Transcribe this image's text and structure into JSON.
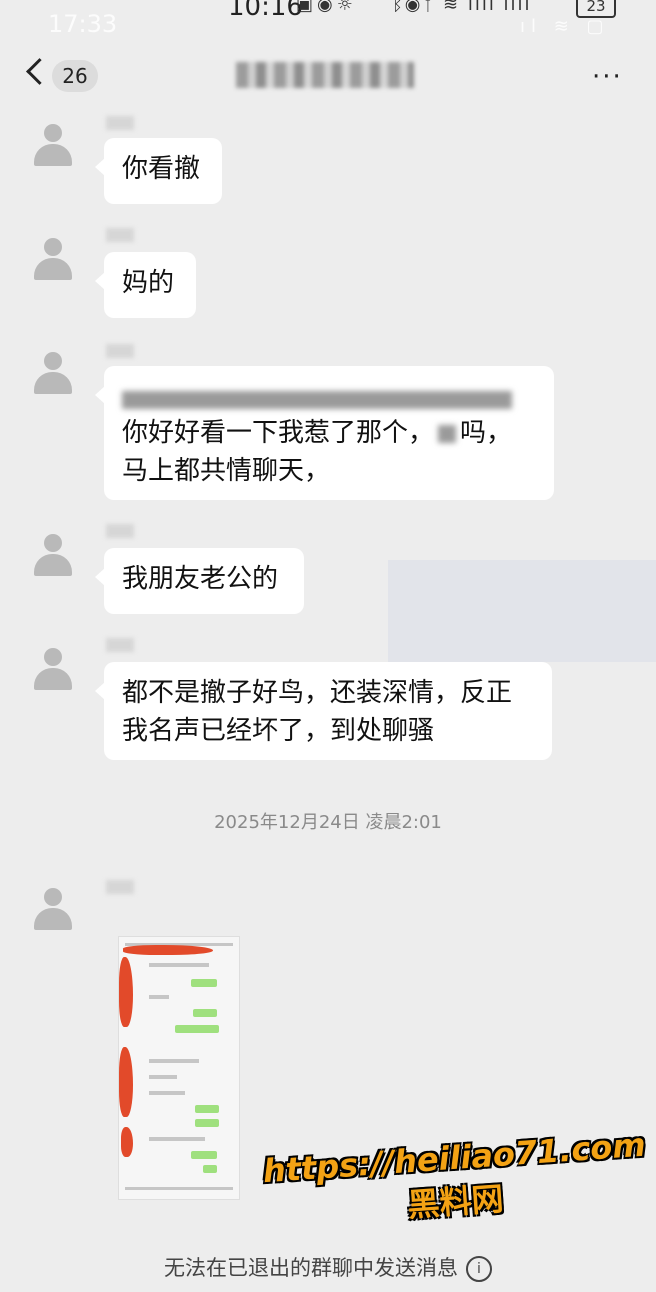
{
  "status_bar": {
    "ghost_time": "17:33",
    "time": "10:16",
    "battery": "23"
  },
  "nav": {
    "unread_count": "26",
    "more": "···"
  },
  "messages": [
    {
      "text": "你看撤"
    },
    {
      "text": "妈的"
    },
    {
      "line1": "你好好看一下我惹了那个，",
      "line1_end": "吗，",
      "line2": "马上都共情聊天，"
    },
    {
      "text": "我朋友老公的"
    },
    {
      "line1": "都不是撤子好鸟，还装深情，反正",
      "line2": "我名声已经坏了，到处聊骚"
    }
  ],
  "timestamp": "2025年12月24日 凌晨2:01",
  "watermark": {
    "url": "https://heiliao71.com",
    "name": "黑料网"
  },
  "footer": {
    "notice": "无法在已退出的群聊中发送消息",
    "info_icon": "i"
  },
  "colors": {
    "background": "#ededed",
    "bubble": "#ffffff",
    "watermark": "#f3a214"
  },
  "icons": [
    "back-chevron-icon",
    "more-dots-icon",
    "avatar-placeholder-icon",
    "info-circle-icon"
  ]
}
